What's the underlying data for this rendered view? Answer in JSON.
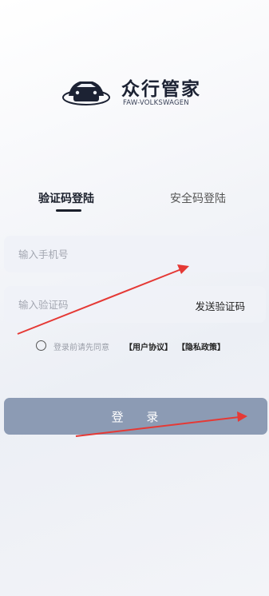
{
  "brand": {
    "title": "众行管家",
    "subtitle": "FAW-VOLKSWAGEN",
    "logo_icon": "car-icon"
  },
  "tabs": [
    {
      "label": "验证码登陆",
      "active": true
    },
    {
      "label": "安全码登陆",
      "active": false
    }
  ],
  "form": {
    "phone_placeholder": "输入手机号",
    "phone_value": "",
    "code_placeholder": "输入验证码",
    "code_value": "",
    "send_code_label": "发送验证码"
  },
  "agreement": {
    "checked": false,
    "prefix": "登录前请先同意",
    "user_agreement": "【用户协议】",
    "privacy_policy": "【隐私政策】"
  },
  "login_button": {
    "label": "登 录"
  },
  "colors": {
    "button": "#8c9bb4",
    "annotation_arrow": "#e53935"
  }
}
